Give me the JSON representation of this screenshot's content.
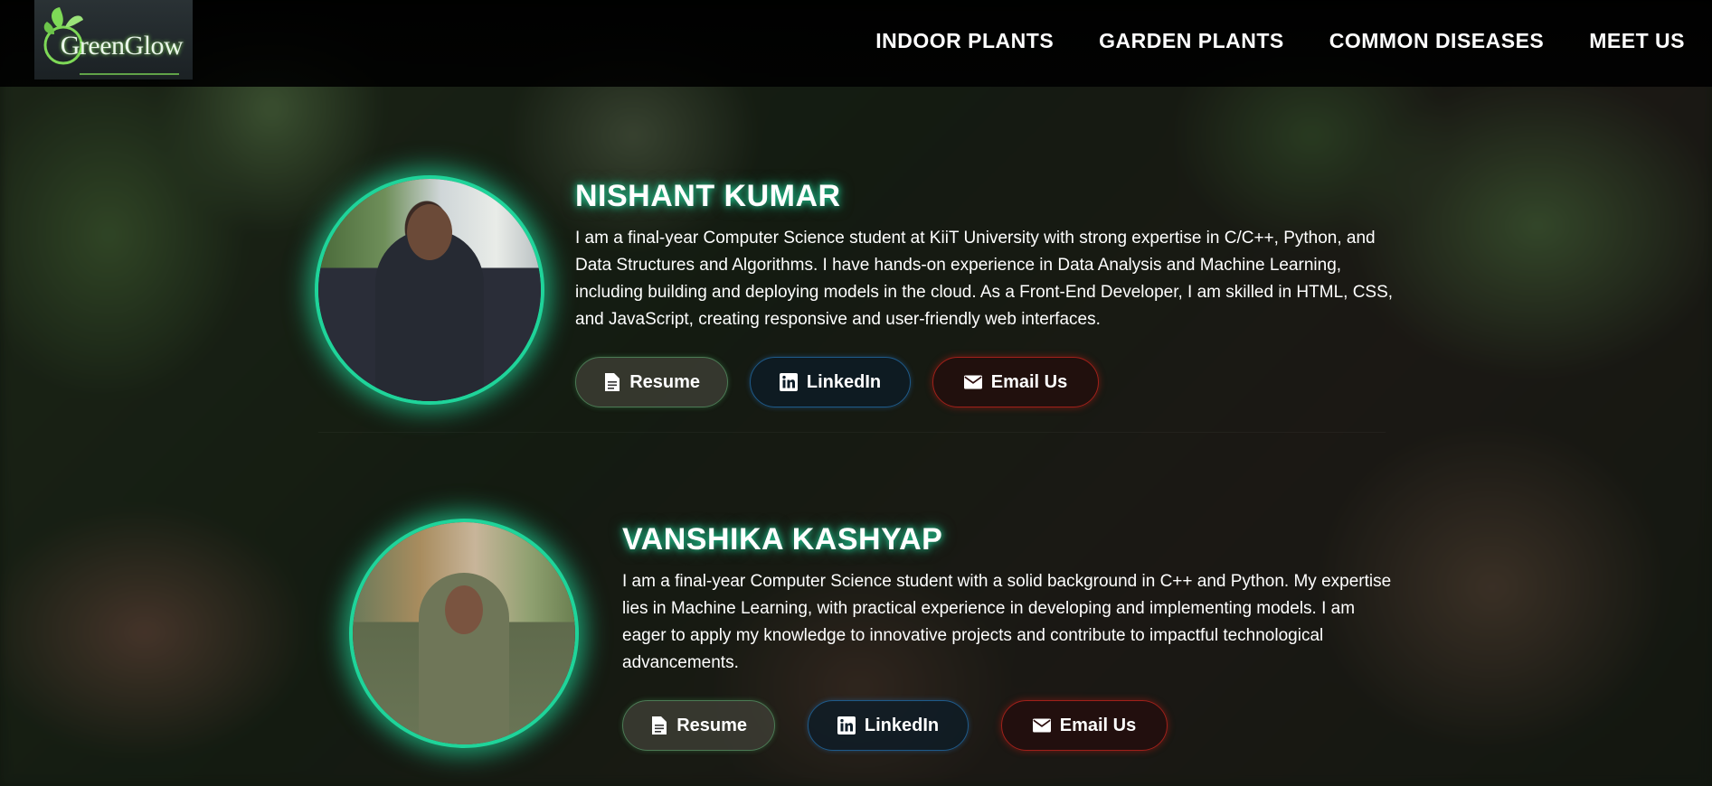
{
  "brand": {
    "name": "GreenGlow",
    "accent": "#7ed957"
  },
  "nav": {
    "items": [
      {
        "label": "INDOOR PLANTS"
      },
      {
        "label": "GARDEN PLANTS"
      },
      {
        "label": "COMMON DISEASES"
      },
      {
        "label": "MEET US"
      }
    ]
  },
  "colors": {
    "glow": "#1fd49a",
    "resume_border": "#4c7a55",
    "linkedin_border": "#1e5a8a",
    "email_border": "#a0201a"
  },
  "members": [
    {
      "name": "NISHANT KUMAR",
      "bio": "I am a final-year Computer Science student at KiiT University with strong expertise in C/C++, Python, and Data Structures and Algorithms. I have hands-on experience in Data Analysis and Machine Learning, including building and deploying models in the cloud. As a Front-End Developer, I am skilled in HTML, CSS, and JavaScript, creating responsive and user-friendly web interfaces.",
      "buttons": {
        "resume": "Resume",
        "linkedin": "LinkedIn",
        "email": "Email Us"
      }
    },
    {
      "name": "VANSHIKA KASHYAP",
      "bio": "I am a final-year Computer Science student with a solid background in C++ and Python. My expertise lies in Machine Learning, with practical experience in developing and implementing models. I am eager to apply my knowledge to innovative projects and contribute to impactful technological advancements.",
      "buttons": {
        "resume": "Resume",
        "linkedin": "LinkedIn",
        "email": "Email Us"
      }
    }
  ],
  "icons": {
    "resume": "file-icon",
    "linkedin": "linkedin-icon",
    "email": "envelope-icon"
  }
}
